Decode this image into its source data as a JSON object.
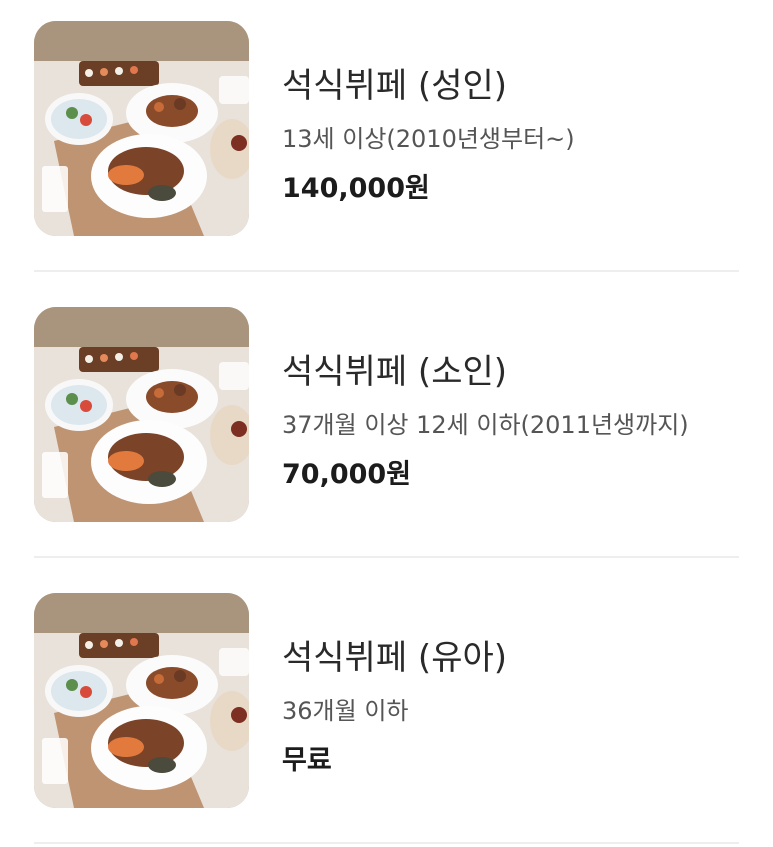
{
  "products": [
    {
      "title": "석식뷔페 (성인)",
      "description": "13세 이상(2010년생부터~)",
      "price": "140,000원",
      "image": "buffet-food-photo"
    },
    {
      "title": "석식뷔페 (소인)",
      "description": "37개월 이상 12세 이하(2011년생까지)",
      "price": "70,000원",
      "image": "buffet-food-photo"
    },
    {
      "title": "석식뷔페 (유아)",
      "description": "36개월 이하",
      "price": "무료",
      "image": "buffet-food-photo"
    }
  ]
}
